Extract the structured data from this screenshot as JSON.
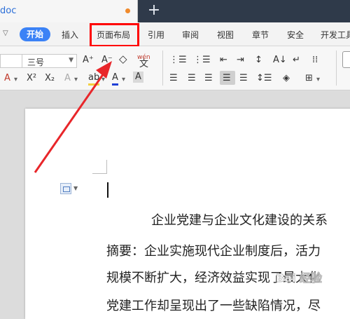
{
  "tab": {
    "name": "doc"
  },
  "menu": {
    "start": "开始",
    "items": [
      "插入",
      "页面布局",
      "引用",
      "审阅",
      "视图",
      "章节",
      "安全",
      "开发工具"
    ]
  },
  "toolbar": {
    "font_size": "三号",
    "grow_font": "A⁺",
    "shrink_font": "A⁻",
    "superscript": "X²",
    "subscript": "X₂",
    "phonetic": "wén"
  },
  "document": {
    "lines": [
      "企业党建与企业文化建设的关系",
      "摘要：企业实施现代企业制度后，活力",
      "规模不断扩大，经济效益实现了最大化",
      "党建工作却呈现出了一些缺陷情况，尽"
    ]
  },
  "watermark": {
    "text": "Bai 经验"
  },
  "colors": {
    "accent": "#3b82f6",
    "highlight": "#ff0000",
    "titlebar": "#2f3a4a"
  }
}
